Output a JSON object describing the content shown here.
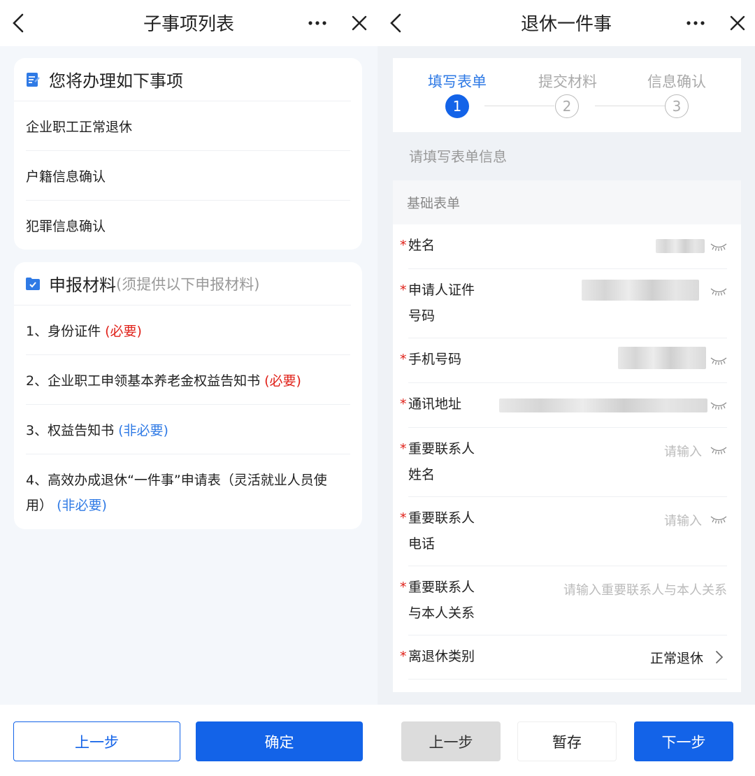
{
  "left": {
    "header": {
      "title": "子事项列表"
    },
    "items_card": {
      "title": "您将办理如下事项",
      "items": [
        {
          "label": "企业职工正常退休"
        },
        {
          "label": "户籍信息确认"
        },
        {
          "label": "犯罪信息确认"
        }
      ]
    },
    "materials_card": {
      "title": "申报材料",
      "subtitle": "(须提供以下申报材料)",
      "items": [
        {
          "label": "1、身份证件",
          "tag": "(必要)"
        },
        {
          "label": "2、企业职工申领基本养老金权益告知书",
          "tag": "(必要)"
        },
        {
          "label": "3、权益告知书",
          "tag": "(非必要)"
        },
        {
          "label": "4、高效办成退休“一件事”申请表（灵活就业人员使用）",
          "tag": "(非必要)"
        }
      ]
    },
    "buttons": {
      "prev": "上一步",
      "confirm": "确定"
    }
  },
  "right": {
    "header": {
      "title": "退休一件事"
    },
    "steps": [
      {
        "label": "填写表单",
        "num": "1"
      },
      {
        "label": "提交材料",
        "num": "2"
      },
      {
        "label": "信息确认",
        "num": "3"
      }
    ],
    "hint": "请填写表单信息",
    "section_title": "基础表单",
    "fields": {
      "name": {
        "star": "*",
        "label": "姓名"
      },
      "id_no": {
        "star": "*",
        "label1": "申请人证件",
        "label2": "号码"
      },
      "phone": {
        "star": "*",
        "label": "手机号码"
      },
      "address": {
        "star": "*",
        "label": "通讯地址"
      },
      "contact_name": {
        "star": "*",
        "label1": "重要联系人",
        "label2": "姓名",
        "placeholder": "请输入"
      },
      "contact_phone": {
        "star": "*",
        "label1": "重要联系人",
        "label2": "电话",
        "placeholder": "请输入"
      },
      "contact_relation": {
        "star": "*",
        "label1": "重要联系人",
        "label2": "与本人关系",
        "placeholder": "请输入重要联系人与本人关系"
      },
      "retire_type": {
        "star": "*",
        "label": "离退休类别",
        "value": "正常退休"
      }
    },
    "buttons": {
      "prev": "上一步",
      "save": "暂存",
      "next": "下一步"
    }
  },
  "colors": {
    "primary": "#1363e8",
    "required": "#e0221a",
    "optional": "#2f7ae5"
  }
}
